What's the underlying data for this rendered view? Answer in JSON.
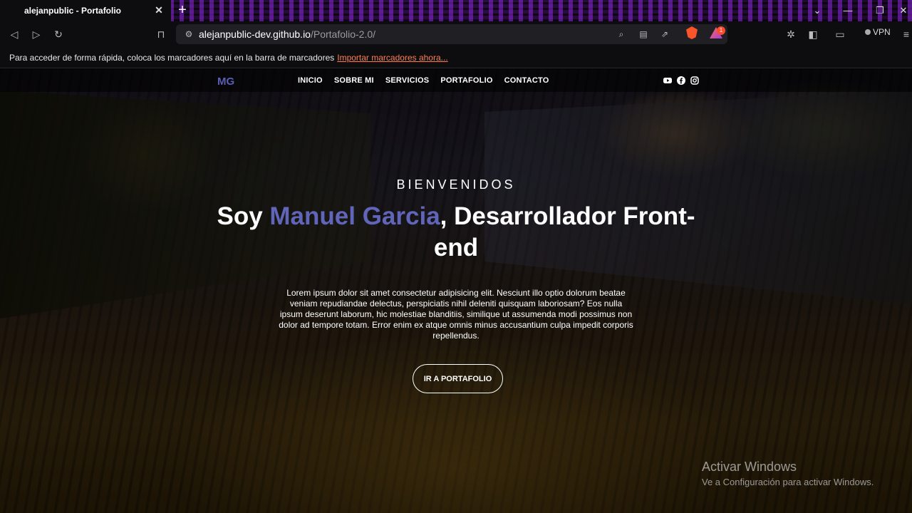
{
  "browser": {
    "tab_title": "alejanpublic - Portafolio",
    "new_tab_symbol": "+",
    "url_host": "alejanpublic-dev.github.io",
    "url_path": "/Portafolio-2.0/",
    "rewards_count": "1",
    "vpn_label": "VPN",
    "bookmarks_hint": "Para acceder de forma rápida, coloca los marcadores aquí en la barra de marcadores",
    "bookmarks_import": "Importar marcadores ahora..."
  },
  "site": {
    "logo": "MG",
    "menu": [
      "INICIO",
      "SOBRE MI",
      "SERVICIOS",
      "PORTAFOLIO",
      "CONTACTO"
    ],
    "social_icons": [
      "youtube-icon",
      "facebook-icon",
      "instagram-icon"
    ]
  },
  "hero": {
    "kicker": "BIENVENIDOS",
    "headline_pre": "Soy ",
    "headline_name": "Manuel Garcia",
    "headline_post": ", Desarrollador Front-end",
    "paragraph": "Lorem ipsum dolor sit amet consectetur adipisicing elit. Nesciunt illo optio dolorum beatae veniam repudiandae delectus, perspiciatis nihil deleniti quisquam laboriosam? Eos nulla ipsum deserunt laborum, hic molestiae blanditiis, similique ut assumenda modi possimus non dolor ad tempore totam. Error enim ex atque omnis minus accusantium culpa impedit corporis repellendus.",
    "cta_label": "IR A PORTAFOLIO"
  },
  "watermark": {
    "title": "Activar Windows",
    "subtitle": "Ve a Configuración para activar Windows."
  },
  "colors": {
    "accent": "#6065b9",
    "logo": "#5a5fb3",
    "bookmark_link": "#ff7f50"
  }
}
